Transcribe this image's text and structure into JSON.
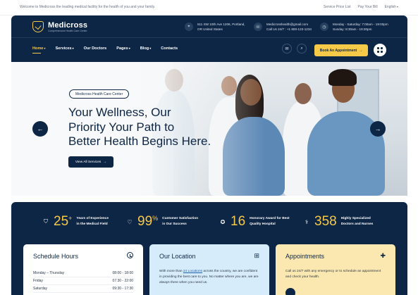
{
  "topbar": {
    "welcome": "Welcome to Medicross the leading medical facility for the health of you and your family.",
    "links": [
      "Service Price List",
      "Pay Your Bill",
      "English"
    ]
  },
  "brand": {
    "name": "Medicross",
    "tagline": "Comprehensive Health Care Center",
    "accent": "#f7c948",
    "navy": "#0e2645"
  },
  "header_info": {
    "address": [
      "511 SW 10th Ave 1206, Portland,",
      "OR United States"
    ],
    "contact": [
      "Medicrosshealth@gmail.com",
      "Call Us 24/7 : +1 800-123-1234"
    ],
    "hours": [
      "Monday - Saturday: 7:00am - 19:00pm",
      "Sunday: 8:30am - 19:30pm"
    ]
  },
  "nav": {
    "items": [
      {
        "label": "Home",
        "caret": true
      },
      {
        "label": "Services",
        "caret": true
      },
      {
        "label": "Our Doctors",
        "caret": false
      },
      {
        "label": "Pages",
        "caret": true
      },
      {
        "label": "Blog",
        "caret": true
      },
      {
        "label": "Contacts",
        "caret": false
      }
    ],
    "appointment_button": "Book An Appointment"
  },
  "hero": {
    "pill": "Medicross Health Care Center",
    "title_lines": [
      "Your Wellness, Our",
      "Priority Your Path to",
      "Better Health Begins Here."
    ],
    "cta": "View All Services"
  },
  "stats": [
    {
      "value": "25",
      "suffix": "+",
      "label": [
        "Years of Experience",
        "in the Medical Field"
      ],
      "icon": "shield-icon"
    },
    {
      "value": "99",
      "suffix": "%",
      "label": [
        "Customer Satisfaction",
        "is Our Success"
      ],
      "icon": "heart-icon"
    },
    {
      "value": "16",
      "suffix": "",
      "label": [
        "Honorary Award for Best",
        "Quality Hospital"
      ],
      "icon": "award-icon"
    },
    {
      "value": "358",
      "suffix": "",
      "label": [
        "Highly Specialized",
        "Doctors and Nurses"
      ],
      "icon": "doctor-icon"
    }
  ],
  "cards": {
    "schedule": {
      "title": "Schedule Hours",
      "rows": [
        {
          "day": "Monday – Thursday",
          "time": "08:00 - 18:00"
        },
        {
          "day": "Friday",
          "time": "07:30 - 22:00"
        },
        {
          "day": "Saturday",
          "time": "09:30 - 17:30"
        }
      ]
    },
    "location": {
      "title": "Our Location",
      "text_pre": "With more than",
      "link": "24 Locations",
      "text_post": "across the country, we are confident in providing the best care to you. No matter where you are, we are always there when you need us."
    },
    "appointments": {
      "title": "Appointments",
      "text": "Call us 24/7 with any emergency or to schedule an appointment and check your health."
    }
  }
}
